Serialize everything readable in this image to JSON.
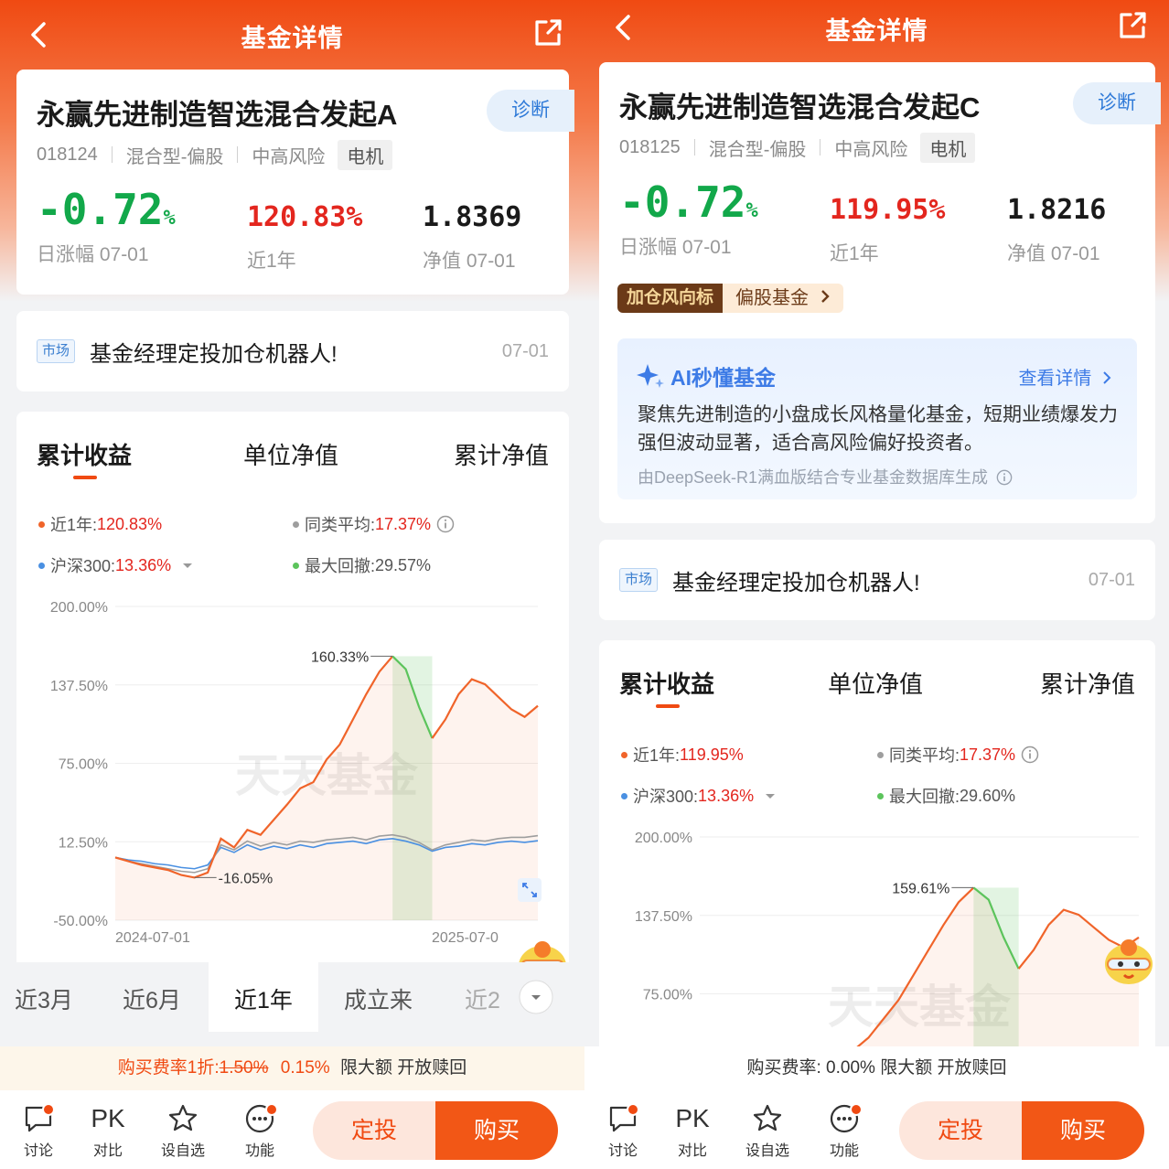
{
  "nav_title": "基金详情",
  "fundA": {
    "name": "永赢先进制造智选混合发起A",
    "diagnose": "诊断",
    "code": "018124",
    "type": "混合型-偏股",
    "risk": "中高风险",
    "theme": "电机",
    "day_change": "-0.72",
    "day_change_unit": "%",
    "day_change_label": "日涨幅 07-01",
    "year_return": "120.83%",
    "year_return_label": "近1年",
    "nav": "1.8369",
    "nav_label": "净值 07-01",
    "market_tag": "市场",
    "market_text": "基金经理定投加仓机器人!",
    "market_date": "07-01",
    "tabs": [
      "累计收益",
      "单位净值",
      "累计净值"
    ],
    "legend": {
      "fund_label": "近1年:",
      "fund_value": "120.83%",
      "avg_label": "同类平均:",
      "avg_value": "17.37%",
      "index_label": "沪深300:",
      "index_value": "13.36%",
      "dd_label": "最大回撤:",
      "dd_value": "29.57%"
    },
    "y_ticks": [
      "200.00%",
      "137.50%",
      "75.00%",
      "12.50%",
      "-50.00%"
    ],
    "x_start": "2024-07-01",
    "x_end": "2025-07-0",
    "peak_label": "160.33%",
    "trough_label": "-16.05%",
    "watermark": "天天基金",
    "periods": [
      "近3月",
      "近6月",
      "近1年",
      "成立来",
      "近2"
    ],
    "active_period": "近1年",
    "fee_prefix": "购买费率1折:",
    "fee_old": "1.50%",
    "fee_new": "0.15%",
    "fee_suffix": "限大额 开放赎回"
  },
  "fundC": {
    "name": "永赢先进制造智选混合发起C",
    "diagnose": "诊断",
    "code": "018125",
    "type": "混合型-偏股",
    "risk": "中高风险",
    "theme": "电机",
    "day_change": "-0.72",
    "day_change_unit": "%",
    "day_change_label": "日涨幅 07-01",
    "year_return": "119.95%",
    "year_return_label": "近1年",
    "nav": "1.8216",
    "nav_label": "净值 07-01",
    "wind_label": "加仓风向标",
    "wind_text": "偏股基金",
    "ai_title": "AI秒懂基金",
    "ai_link": "查看详情",
    "ai_text": "聚焦先进制造的小盘成长风格量化基金，短期业绩爆发力强但波动显著，适合高风险偏好投资者。",
    "ai_foot": "由DeepSeek-R1满血版结合专业基金数据库生成",
    "market_tag": "市场",
    "market_text": "基金经理定投加仓机器人!",
    "market_date": "07-01",
    "tabs": [
      "累计收益",
      "单位净值",
      "累计净值"
    ],
    "legend": {
      "fund_label": "近1年:",
      "fund_value": "119.95%",
      "avg_label": "同类平均:",
      "avg_value": "17.37%",
      "index_label": "沪深300:",
      "index_value": "13.36%",
      "dd_label": "最大回撤:",
      "dd_value": "29.60%"
    },
    "y_ticks": [
      "200.00%",
      "137.50%",
      "75.00%"
    ],
    "peak_label": "159.61%",
    "watermark": "天天基金",
    "fee_text": "购买费率: 0.00% 限大额 开放赎回"
  },
  "bottom": {
    "items": [
      "讨论",
      "对比",
      "设自选",
      "功能"
    ],
    "pk": "PK",
    "dingtou": "定投",
    "buy": "购买"
  },
  "colors": {
    "brand": "#f04a12",
    "fund_line": "#f0642a",
    "drawdown": "#5cc45c",
    "index_line": "#4a90e2",
    "avg_line": "#9e9e9e"
  },
  "chart_data": [
    {
      "type": "line",
      "title": "",
      "x": [
        "2024-07-01",
        "2025-07-0"
      ],
      "ylim": [
        -50,
        200
      ],
      "yticks": [
        200,
        137.5,
        75,
        12.5,
        -50
      ],
      "series": [
        {
          "name": "近1年",
          "values": [
            0,
            -3,
            -6,
            -8,
            -10,
            -14,
            -16.05,
            -12,
            15,
            8,
            22,
            18,
            30,
            42,
            55,
            60,
            78,
            90,
            110,
            130,
            148,
            160.33,
            150,
            120,
            95,
            110,
            130,
            142,
            138,
            128,
            118,
            112,
            120.83
          ]
        },
        {
          "name": "沪深300",
          "values": [
            0,
            -2,
            -3,
            -5,
            -6,
            -8,
            -9,
            -6,
            8,
            4,
            10,
            6,
            9,
            7,
            10,
            8,
            11,
            12,
            13,
            11,
            14,
            15,
            13,
            10,
            5,
            8,
            9,
            11,
            10,
            12,
            13,
            12,
            13.36
          ]
        },
        {
          "name": "同类平均",
          "values": [
            0,
            -3,
            -5,
            -7,
            -9,
            -11,
            -12,
            -9,
            10,
            6,
            13,
            9,
            12,
            10,
            13,
            12,
            14,
            15,
            16,
            14,
            17,
            18,
            16,
            12,
            6,
            10,
            12,
            14,
            13,
            15,
            16,
            16,
            17.37
          ]
        }
      ],
      "annotations": [
        "160.33%",
        "-16.05%"
      ],
      "max_drawdown": "29.57%"
    },
    {
      "type": "line",
      "title": "",
      "ylim": [
        -50,
        200
      ],
      "yticks": [
        200,
        137.5,
        75
      ],
      "series": [
        {
          "name": "近1年",
          "values": [
            30,
            40,
            55,
            70,
            90,
            110,
            130,
            148,
            159.61,
            150,
            120,
            95,
            110,
            130,
            142,
            138,
            128,
            118,
            112,
            119.95
          ]
        }
      ],
      "annotations": [
        "159.61%"
      ],
      "max_drawdown": "29.60%"
    }
  ]
}
